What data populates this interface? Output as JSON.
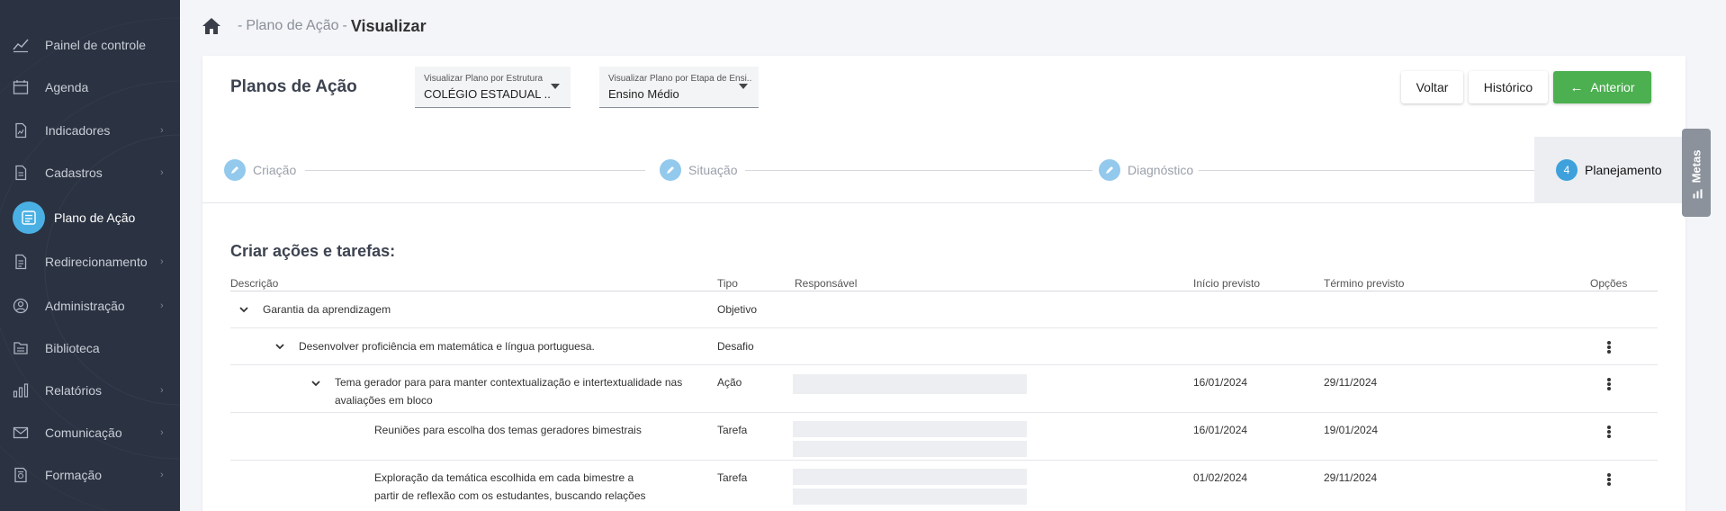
{
  "sidebar": {
    "items": [
      {
        "label": "Painel de controle",
        "icon": "dashboard-icon",
        "chevron": false
      },
      {
        "label": "Agenda",
        "icon": "calendar-icon",
        "chevron": false
      },
      {
        "label": "Indicadores",
        "icon": "indicators-icon",
        "chevron": true
      },
      {
        "label": "Cadastros",
        "icon": "document-icon",
        "chevron": true
      },
      {
        "label": "Plano de Ação",
        "icon": "plan-icon",
        "chevron": false,
        "active": true
      },
      {
        "label": "Redirecionamento",
        "icon": "redirect-icon",
        "chevron": true
      },
      {
        "label": "Administração",
        "icon": "user-circle-icon",
        "chevron": true
      },
      {
        "label": "Biblioteca",
        "icon": "library-icon",
        "chevron": false
      },
      {
        "label": "Relatórios",
        "icon": "bar-chart-icon",
        "chevron": true
      },
      {
        "label": "Comunicação",
        "icon": "mail-icon",
        "chevron": true
      },
      {
        "label": "Formação",
        "icon": "certificate-icon",
        "chevron": true
      }
    ],
    "chevron_glyph": "›"
  },
  "breadcrumb": {
    "sep": "-",
    "link": "Plano de Ação",
    "sep2": "-",
    "current": "Visualizar"
  },
  "header": {
    "title": "Planos de Ação",
    "select_estrutura": {
      "caption": "Visualizar Plano por Estrutura",
      "value": "COLÉGIO ESTADUAL ..."
    },
    "select_etapa": {
      "caption": "Visualizar Plano por Etapa de Ensi...",
      "value": "Ensino Médio"
    },
    "buttons": {
      "voltar": "Voltar",
      "historico": "Histórico",
      "anterior": "Anterior",
      "anterior_arrow": "←"
    }
  },
  "stepper": {
    "steps": [
      {
        "label": "Criação",
        "status": "done"
      },
      {
        "label": "Situação",
        "status": "done"
      },
      {
        "label": "Diagnóstico",
        "status": "done"
      },
      {
        "label": "Planejamento",
        "status": "active",
        "number": "4"
      }
    ]
  },
  "section": {
    "title": "Criar ações e tarefas:",
    "columns": {
      "descricao": "Descrição",
      "tipo": "Tipo",
      "responsavel": "Responsável",
      "inicio": "Início previsto",
      "termino": "Término previsto",
      "opcoes": "Opções"
    },
    "rows": [
      {
        "desc": "Garantia da aprendizagem",
        "tipo": "Objetivo",
        "inicio": "",
        "termino": ""
      },
      {
        "desc": "Desenvolver proficiência em matemática e língua portuguesa.",
        "tipo": "Desafio",
        "inicio": "",
        "termino": ""
      },
      {
        "desc_line1": "Tema gerador para para manter contextualização e intertextualidade nas",
        "desc_line2": "avaliações em bloco",
        "tipo": "Ação",
        "inicio": "16/01/2024",
        "termino": "29/11/2024"
      },
      {
        "desc": "Reuniões para escolha dos temas geradores bimestrais",
        "tipo": "Tarefa",
        "inicio": "16/01/2024",
        "termino": "19/01/2024"
      },
      {
        "desc_line1": "Exploração da temática escolhida em cada bimestre a",
        "desc_line2": "partir de reflexão com os estudantes, buscando relações",
        "tipo": "Tarefa",
        "inicio": "01/02/2024",
        "termino": "29/11/2024"
      }
    ]
  },
  "metas_tab": {
    "label": "Metas",
    "icon": "bar-chart-icon"
  },
  "colors": {
    "sidebar_bg": "#2b3241",
    "accent_blue": "#3ea1db",
    "primary_green": "#4caf50"
  }
}
